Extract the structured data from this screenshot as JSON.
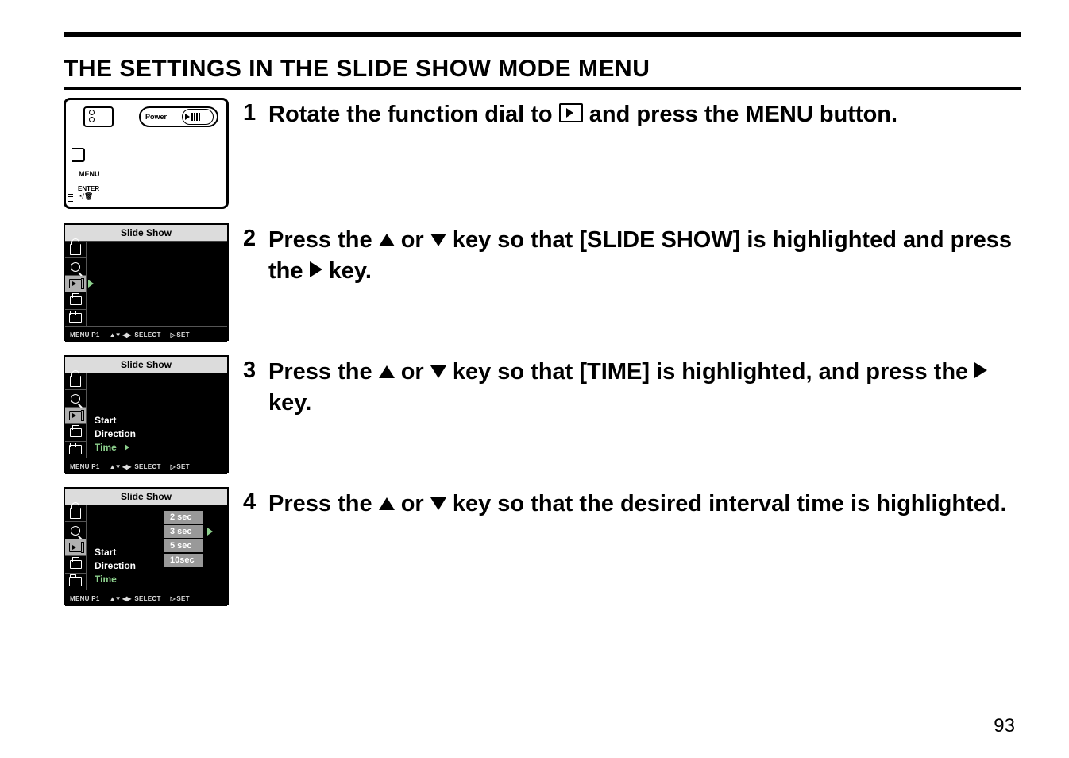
{
  "heading": "THE SETTINGS IN THE SLIDE SHOW MODE MENU",
  "page_number": "93",
  "camera": {
    "power_label": "Power",
    "menu_label": "MENU",
    "enter_label": "ENTER"
  },
  "lcd": {
    "title": "Slide Show",
    "footer_menu": "MENU P1",
    "footer_select": "SELECT",
    "footer_set": "SET",
    "items_screen3": [
      "Start",
      "Direction",
      "Time"
    ],
    "items_screen4": {
      "left": [
        "Start",
        "Direction",
        "Time"
      ],
      "options": [
        "2 sec",
        "3 sec",
        "5 sec",
        "10sec"
      ]
    }
  },
  "steps": {
    "s1": {
      "num": "1",
      "pre": "Rotate the function dial to ",
      "post": " and press the MENU button."
    },
    "s2": {
      "num": "2",
      "pre": "Press the ",
      "mid1": " or ",
      "mid2": " key so that [SLIDE SHOW] is highlighted and press the ",
      "post": " key."
    },
    "s3": {
      "num": "3",
      "pre": "Press the ",
      "mid1": " or ",
      "mid2": " key so that [TIME] is highlighted, and press the ",
      "post": " key."
    },
    "s4": {
      "num": "4",
      "pre": "Press the ",
      "mid1": " or ",
      "post": "  key so that the desired interval time is highlighted."
    }
  }
}
